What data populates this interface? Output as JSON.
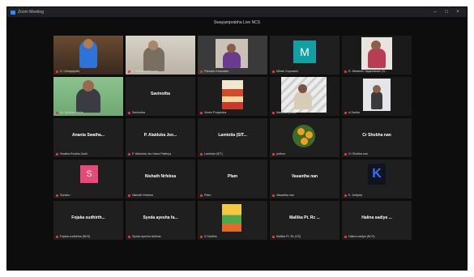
{
  "window": {
    "title": "Zoom Meeting",
    "controls": [
      "–",
      "□",
      "×"
    ]
  },
  "meeting": {
    "title": "Swayamprabha Live NCS"
  },
  "tiles": [
    {
      "type": "video",
      "variant": "v-blue",
      "name": "S. Chhayajoshi",
      "active": true
    },
    {
      "type": "video",
      "variant": "v-room",
      "name": "E. Nandanartha one"
    },
    {
      "type": "video",
      "variant": "v-purple",
      "name": "Pamadu Kanaraba"
    },
    {
      "type": "avatar",
      "variant": "v-teal",
      "letter": "M",
      "name": "Mitrah Gopuasht"
    },
    {
      "type": "video",
      "variant": "v-portrait",
      "name": "R. Minakshi Jayaprakash (N..."
    },
    {
      "type": "video",
      "variant": "v-green",
      "name": "Dr. Jyotsna Josha"
    },
    {
      "type": "text",
      "display": "Savinotha",
      "name": "Savinotha"
    },
    {
      "type": "video",
      "variant": "v-food",
      "name": "Vinnie Poojandra"
    },
    {
      "type": "video",
      "variant": "v-stairs",
      "name": "Maninda phinal"
    },
    {
      "type": "video",
      "variant": "v-wall",
      "name": "A.Sadha"
    },
    {
      "type": "text",
      "display": "Ananta  Swatha...",
      "name": "Swatha Routha Joshi"
    },
    {
      "type": "text",
      "display": "P. Alaiduba  Jeo...",
      "name": "P. Alaiduba Jeo Hana Patitriya"
    },
    {
      "type": "text",
      "display": "Lamtotia  (SIT...",
      "name": "Lamtotia (SIT)"
    },
    {
      "type": "video",
      "variant": "v-flower",
      "name": "judtrva"
    },
    {
      "type": "text",
      "display": "Cr Shobha  nan",
      "name": "Cr Shobha nan"
    },
    {
      "type": "avatar",
      "variant": "v-pink",
      "letter": "S",
      "name": "Sonabo"
    },
    {
      "type": "text",
      "display": "Nishath Nrfebsa",
      "name": "Nishath Nrfebsa"
    },
    {
      "type": "text",
      "display": "Pfam",
      "name": "Pfam"
    },
    {
      "type": "text",
      "display": "Vasantha  nan",
      "name": "Vasantha nan"
    },
    {
      "type": "avatar",
      "variant": "v-x",
      "letter": "K",
      "name": "K. Jedipria"
    },
    {
      "type": "text",
      "display": "Fojaka  sudhirth...",
      "name": "Fojaka sudhirtha (NKS)"
    },
    {
      "type": "text",
      "display": "Syeda  ayesha  fa...",
      "name": "Syeda ayesha fathima"
    },
    {
      "type": "video",
      "variant": "v-cartoon",
      "name": "S.Sabitha"
    },
    {
      "type": "text",
      "display": "Mallika  Pt. Rc ...",
      "name": "Mallika Pt. Rc (VS)"
    },
    {
      "type": "text",
      "display": "Halina  sadiya ...",
      "name": "Halina sadiya (NCS)"
    }
  ]
}
